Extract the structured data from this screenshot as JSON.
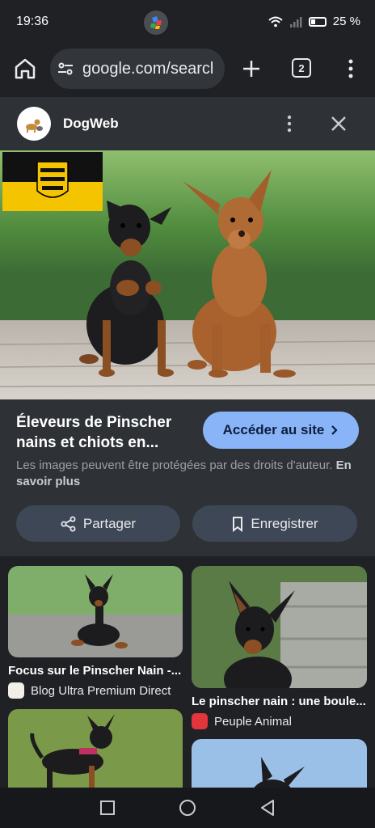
{
  "status_bar": {
    "time": "19:36",
    "battery": "25 %"
  },
  "browser": {
    "url": "google.com/searcl",
    "tab_count": "2"
  },
  "viewer": {
    "site_name": "DogWeb",
    "title": "Éleveurs de Pinscher nains et chiots en...",
    "visit_label": "Accéder au site",
    "copyright_text": "Les images peuvent être protégées par des droits d'auteur.",
    "learn_more": "En savoir plus",
    "share_label": "Partager",
    "save_label": "Enregistrer"
  },
  "results": [
    {
      "caption": "Focus sur le Pinscher Nain -...",
      "source": "Blog Ultra Premium Direct"
    },
    {
      "caption": "Le pinscher nain : une boule...",
      "source": "Peuple Animal"
    }
  ]
}
